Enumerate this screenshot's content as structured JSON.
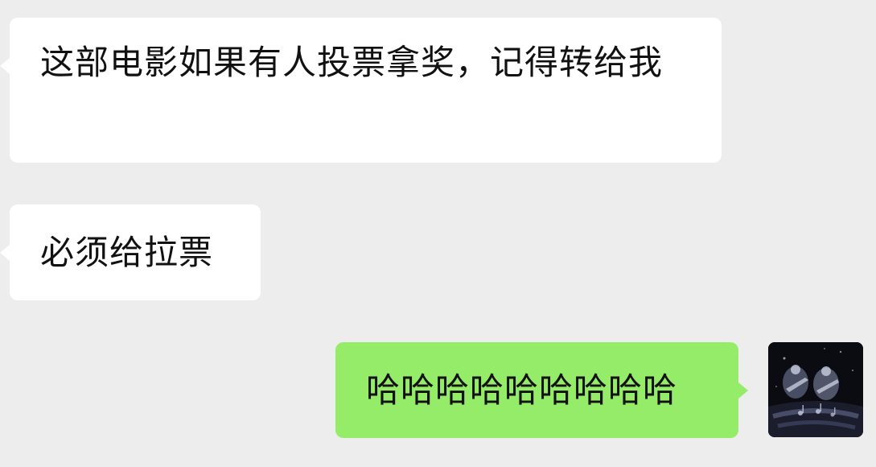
{
  "chat": {
    "messages": [
      {
        "sender": "other",
        "text": "这部电影如果有人投票拿奖，记得转给我"
      },
      {
        "sender": "other",
        "text": "必须给拉票"
      },
      {
        "sender": "self",
        "text": "哈哈哈哈哈哈哈哈哈"
      }
    ]
  },
  "colors": {
    "background": "#ededed",
    "incoming_bubble": "#ffffff",
    "outgoing_bubble": "#95ec69",
    "text": "#111111"
  },
  "icons": {
    "self_avatar": "avatar-photo"
  }
}
